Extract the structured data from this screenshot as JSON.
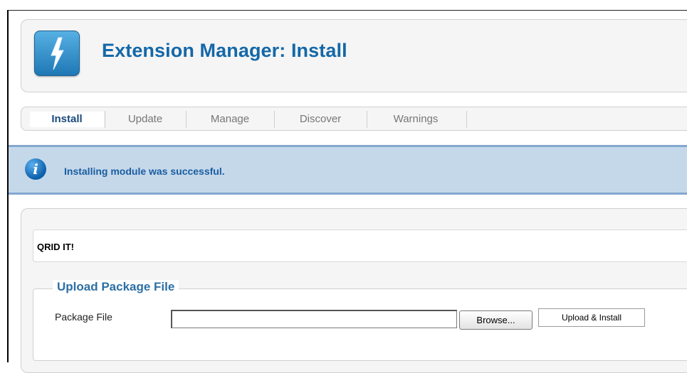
{
  "header": {
    "title": "Extension Manager: Install",
    "icon": "lightning-bolt-icon",
    "icon_color": "#2b8bcb"
  },
  "tabs": [
    {
      "label": "Install",
      "active": true
    },
    {
      "label": "Update",
      "active": false
    },
    {
      "label": "Manage",
      "active": false
    },
    {
      "label": "Discover",
      "active": false
    },
    {
      "label": "Warnings",
      "active": false
    }
  ],
  "message": {
    "icon": "info-icon",
    "text": "Installing module was successful.",
    "background": "#c5d8ea"
  },
  "content": {
    "section_title": "QRID IT!",
    "upload": {
      "legend": "Upload Package File",
      "field_label": "Package File",
      "file_value": "",
      "browse_label": "Browse...",
      "submit_label": "Upload & Install"
    }
  }
}
